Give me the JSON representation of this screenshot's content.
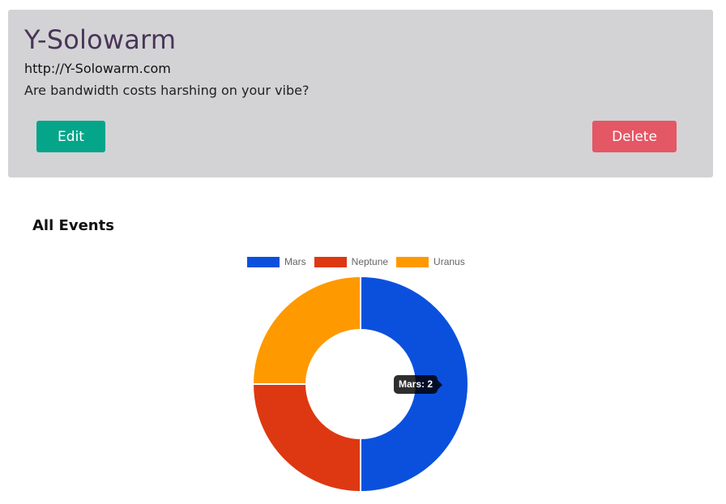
{
  "card": {
    "title": "Y-Solowarm",
    "url": "http://Y-Solowarm.com",
    "description": "Are bandwidth costs harshing on your vibe?",
    "edit_label": "Edit",
    "delete_label": "Delete"
  },
  "section": {
    "title": "All Events"
  },
  "tooltip": {
    "label": "Mars",
    "value": "2"
  },
  "chart_data": {
    "type": "pie",
    "legend_position": "top",
    "categories": [
      "Mars",
      "Neptune",
      "Uranus"
    ],
    "values": [
      2,
      1,
      1
    ],
    "colors": [
      "#0b50dd",
      "#dd3812",
      "#ff9900"
    ]
  }
}
